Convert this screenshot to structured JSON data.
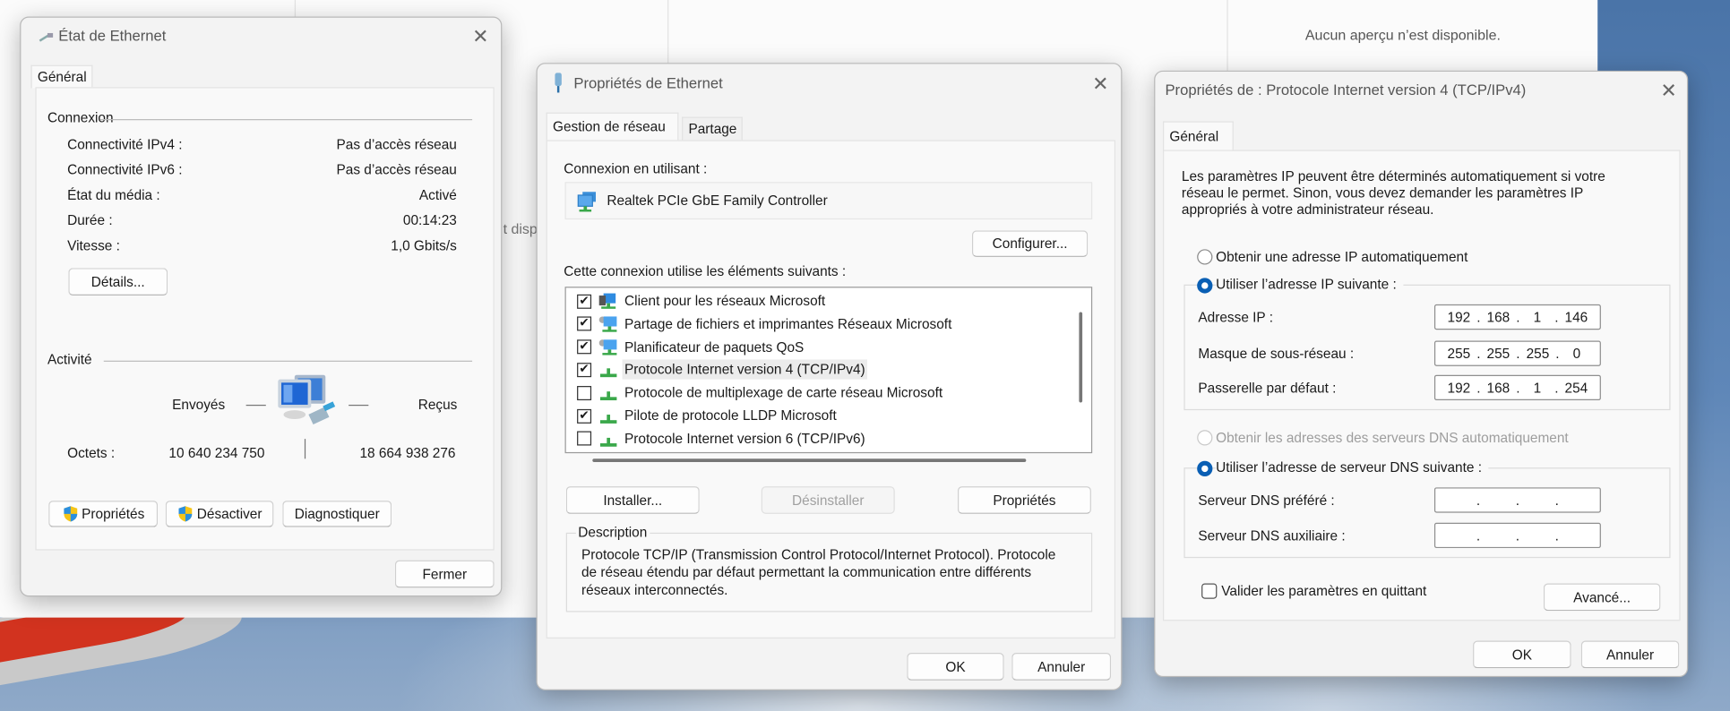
{
  "background": {
    "preview_text": "Aucun aperçu n’est disponible.",
    "partial_text": "t disp"
  },
  "status_dialog": {
    "title": "État de Ethernet",
    "tab": "Général",
    "connection_heading": "Connexion",
    "rows": [
      {
        "label": "Connectivité IPv4 :",
        "value": "Pas d’accès réseau"
      },
      {
        "label": "Connectivité IPv6 :",
        "value": "Pas d’accès réseau"
      },
      {
        "label": "État du média :",
        "value": "Activé"
      },
      {
        "label": "Durée :",
        "value": "00:14:23"
      },
      {
        "label": "Vitesse :",
        "value": "1,0 Gbits/s"
      }
    ],
    "details_button": "Détails...",
    "activity_heading": "Activité",
    "sent_label": "Envoyés",
    "received_label": "Reçus",
    "bytes_label": "Octets :",
    "bytes_sent": "10 640 234 750",
    "bytes_received": "18 664 938 276",
    "properties_button": "Propriétés",
    "disable_button": "Désactiver",
    "diagnose_button": "Diagnostiquer",
    "close_button": "Fermer"
  },
  "props_dialog": {
    "title": "Propriétés de Ethernet",
    "tabs": [
      "Gestion de réseau",
      "Partage"
    ],
    "connect_using_label": "Connexion en utilisant :",
    "adapter": "Realtek PCIe GbE Family Controller",
    "configure_button": "Configurer...",
    "items_label": "Cette connexion utilise les éléments suivants :",
    "items": [
      {
        "label": "Client pour les réseaux Microsoft",
        "checked": true,
        "icon": "client-icon"
      },
      {
        "label": "Partage de fichiers et imprimantes Réseaux Microsoft",
        "checked": true,
        "icon": "service-icon"
      },
      {
        "label": "Planificateur de paquets QoS",
        "checked": true,
        "icon": "service-icon"
      },
      {
        "label": "Protocole Internet version 4 (TCP/IPv4)",
        "checked": true,
        "icon": "protocol-icon",
        "selected": true
      },
      {
        "label": "Protocole de multiplexage de carte réseau Microsoft",
        "checked": false,
        "icon": "protocol-icon"
      },
      {
        "label": "Pilote de protocole LLDP Microsoft",
        "checked": true,
        "icon": "protocol-icon"
      },
      {
        "label": "Protocole Internet version 6 (TCP/IPv6)",
        "checked": false,
        "icon": "protocol-icon"
      }
    ],
    "install_button": "Installer...",
    "uninstall_button": "Désinstaller",
    "properties_button": "Propriétés",
    "description_heading": "Description",
    "description_lines": [
      "Protocole TCP/IP (Transmission Control Protocol/Internet Protocol). Protocole",
      "de réseau étendu par défaut permettant la communication entre différents",
      "réseaux interconnectés."
    ],
    "ok_button": "OK",
    "cancel_button": "Annuler"
  },
  "ipv4_dialog": {
    "title": "Propriétés de : Protocole Internet version 4 (TCP/IPv4)",
    "tab": "Général",
    "intro_lines": [
      "Les paramètres IP peuvent être déterminés automatiquement si votre",
      "réseau le permet. Sinon, vous devez demander les paramètres IP",
      "appropriés à votre administrateur réseau."
    ],
    "auto_ip_label": "Obtenir une adresse IP automatiquement",
    "manual_ip_label": "Utiliser l’adresse IP suivante :",
    "ip_label": "Adresse IP :",
    "ip_value": [
      "192",
      "168",
      "1",
      "146"
    ],
    "mask_label": "Masque de sous-réseau :",
    "mask_value": [
      "255",
      "255",
      "255",
      "0"
    ],
    "gateway_label": "Passerelle par défaut :",
    "gateway_value": [
      "192",
      "168",
      "1",
      "254"
    ],
    "auto_dns_label": "Obtenir les adresses des serveurs DNS automatiquement",
    "manual_dns_label": "Utiliser l’adresse de serveur DNS suivante :",
    "preferred_dns_label": "Serveur DNS préféré :",
    "alternate_dns_label": "Serveur DNS auxiliaire :",
    "validate_label": "Valider les paramètres en quittant",
    "advanced_button": "Avancé...",
    "ok_button": "OK",
    "cancel_button": "Annuler"
  }
}
